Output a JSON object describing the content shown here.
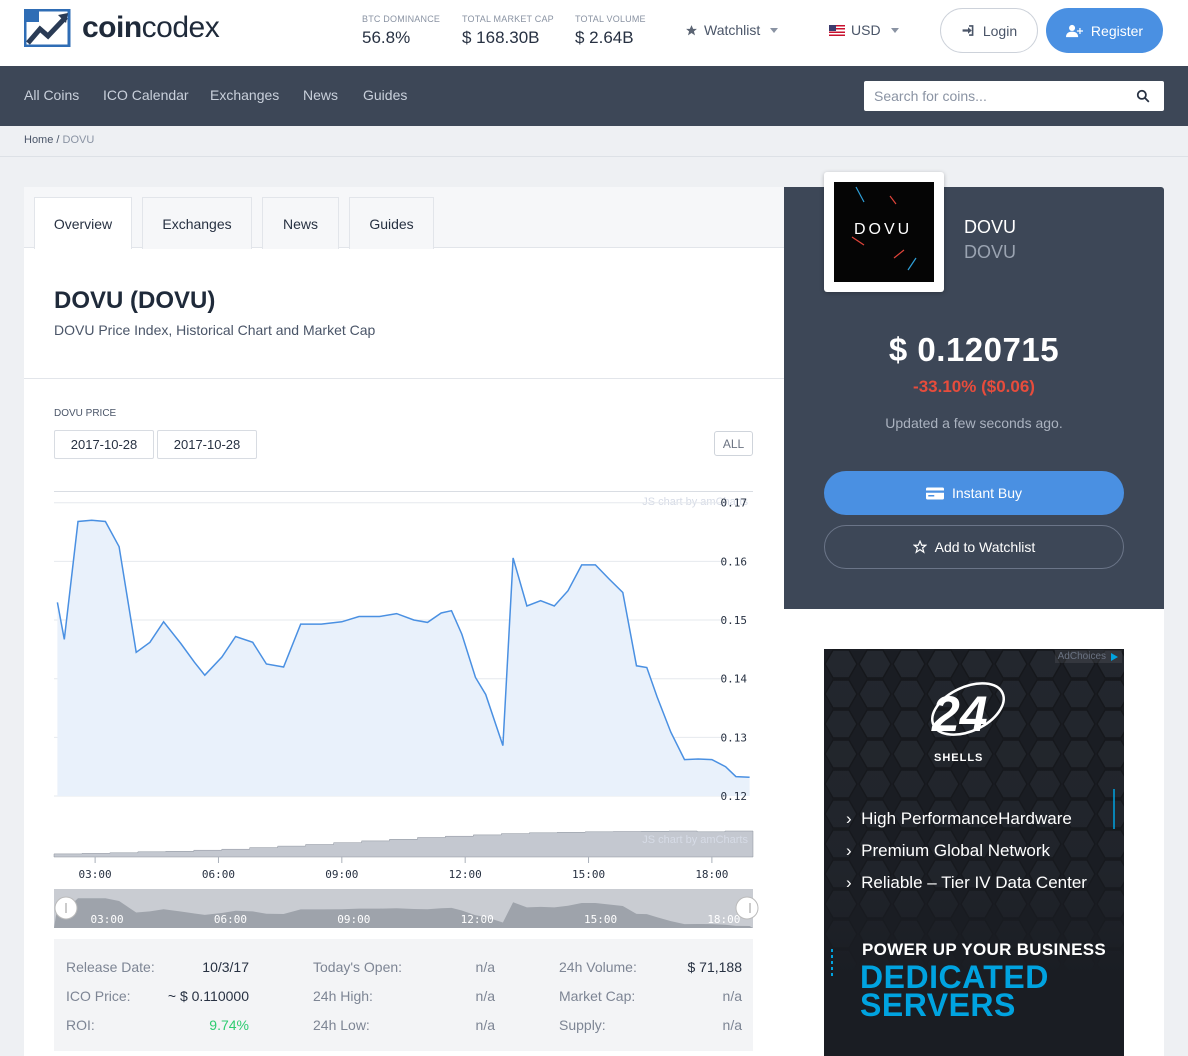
{
  "header": {
    "logo_bold": "coin",
    "logo_light": "codex",
    "stats": [
      {
        "label": "BTC DOMINANCE",
        "value": "56.8%"
      },
      {
        "label": "TOTAL MARKET CAP",
        "value": "$ 168.30B"
      },
      {
        "label": "TOTAL VOLUME",
        "value": "$ 2.64B"
      }
    ],
    "watchlist": "Watchlist",
    "currency": "USD",
    "login": "Login",
    "register": "Register"
  },
  "nav": {
    "items": [
      "All Coins",
      "ICO Calendar",
      "Exchanges",
      "News",
      "Guides"
    ],
    "search_placeholder": "Search for coins..."
  },
  "breadcrumb": {
    "home": "Home",
    "current": "DOVU"
  },
  "tabs": [
    "Overview",
    "Exchanges",
    "News",
    "Guides"
  ],
  "coin": {
    "title": "DOVU (DOVU)",
    "subtitle": "DOVU Price Index, Historical Chart and Market Cap",
    "price_label": "DOVU PRICE",
    "date_from": "2017-10-28",
    "date_to": "2017-10-28",
    "range_all": "ALL",
    "watermark": "JS chart by amCharts"
  },
  "chart_data": {
    "type": "area",
    "x": [
      "02:05",
      "02:15",
      "02:35",
      "02:55",
      "03:15",
      "03:35",
      "04:00",
      "04:20",
      "04:40",
      "05:05",
      "05:25",
      "05:40",
      "06:05",
      "06:25",
      "06:50",
      "07:10",
      "07:35",
      "08:00",
      "08:30",
      "09:00",
      "09:25",
      "09:55",
      "10:20",
      "10:45",
      "11:05",
      "11:25",
      "11:40",
      "11:55",
      "12:15",
      "12:30",
      "12:55",
      "13:10",
      "13:30",
      "13:50",
      "14:10",
      "14:30",
      "14:50",
      "15:10",
      "15:30",
      "15:50",
      "16:10",
      "16:25",
      "16:40",
      "17:00",
      "17:20",
      "17:40",
      "18:00",
      "18:20",
      "18:35",
      "18:55"
    ],
    "values": [
      0.153,
      0.1467,
      0.1668,
      0.167,
      0.1668,
      0.1625,
      0.1445,
      0.1462,
      0.1497,
      0.146,
      0.1428,
      0.1406,
      0.1437,
      0.1472,
      0.1462,
      0.1425,
      0.142,
      0.1493,
      0.1493,
      0.1497,
      0.1506,
      0.1506,
      0.1511,
      0.15,
      0.1496,
      0.1512,
      0.1516,
      0.1476,
      0.1402,
      0.1373,
      0.1286,
      0.1606,
      0.1524,
      0.1533,
      0.1524,
      0.155,
      0.1594,
      0.1594,
      0.157,
      0.1547,
      0.1422,
      0.1419,
      0.1369,
      0.1309,
      0.1262,
      0.1263,
      0.1262,
      0.125,
      0.1233,
      0.1232
    ],
    "x_ticks": [
      "03:00",
      "06:00",
      "09:00",
      "12:00",
      "15:00",
      "18:00"
    ],
    "y_ticks": [
      0.17,
      0.16,
      0.15,
      0.14,
      0.13,
      0.12
    ],
    "ylim": [
      0.12,
      0.172
    ],
    "volume_values": [
      0.12,
      0.14,
      0.16,
      0.2,
      0.22,
      0.26,
      0.3,
      0.36,
      0.42,
      0.48,
      0.55,
      0.62,
      0.68,
      0.75,
      0.8,
      0.85,
      0.9,
      0.93,
      0.95,
      0.97,
      0.98,
      0.99,
      1.0,
      0.97,
      1.0
    ],
    "colors": {
      "line": "#4a90e2",
      "fill": "#e9f1fb",
      "volume": "#c4c8d0"
    }
  },
  "stats": {
    "col1": [
      {
        "label": "Release Date:",
        "value": "10/3/17"
      },
      {
        "label": "ICO Price:",
        "value": "~ $ 0.110000"
      },
      {
        "label": "ROI:",
        "value": "9.74%"
      }
    ],
    "col2": [
      {
        "label": "Today's Open:",
        "value": "n/a"
      },
      {
        "label": "24h High:",
        "value": "n/a"
      },
      {
        "label": "24h Low:",
        "value": "n/a"
      }
    ],
    "col3": [
      {
        "label": "24h Volume:",
        "value": "$ 71,188"
      },
      {
        "label": "Market Cap:",
        "value": "n/a"
      },
      {
        "label": "Supply:",
        "value": "n/a"
      }
    ]
  },
  "sidebar": {
    "logo_text": "DOVU",
    "name": "DOVU",
    "symbol": "DOVU",
    "price": "$ 0.120715",
    "change": "-33.10% ($0.06)",
    "updated": "Updated a few seconds ago.",
    "instant_buy": "Instant Buy",
    "add_watchlist": "Add to Watchlist"
  },
  "ad": {
    "choices": "AdChoices",
    "brand_number": "24",
    "brand_name": "SHELLS",
    "lines": [
      "High PerformanceHardware",
      "Premium Global Network",
      "Reliable – Tier IV Data Center"
    ],
    "power": "POWER UP YOUR BUSINESS",
    "big1": "DEDICATED",
    "big2": "SERVERS",
    "colors": {
      "accent": "#00a3e0",
      "bg": "#1a1d23"
    }
  }
}
